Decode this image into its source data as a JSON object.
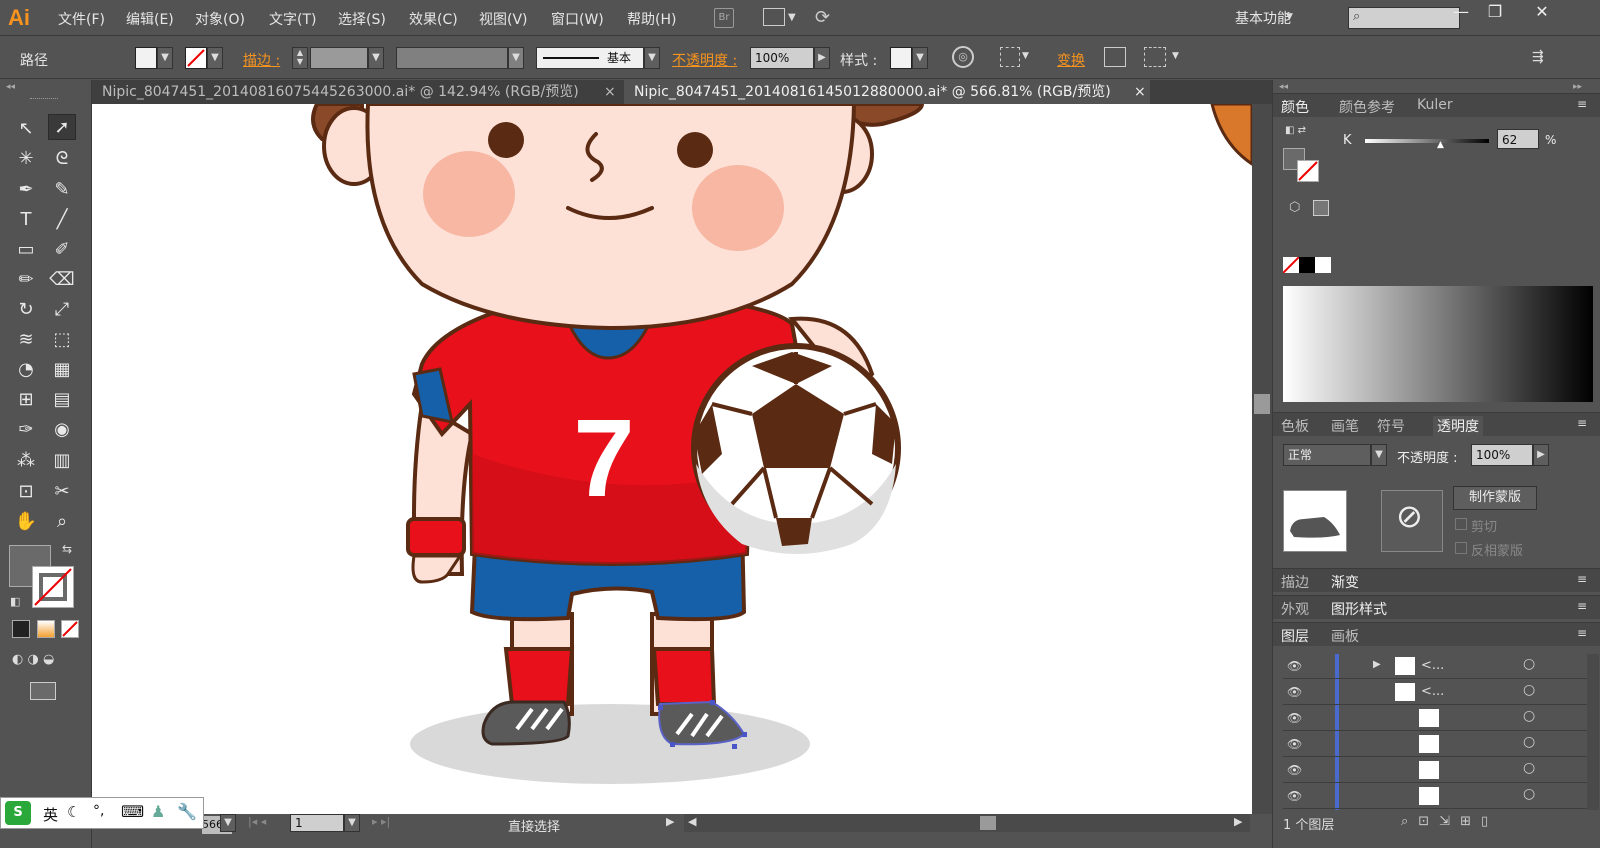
{
  "app": {
    "logo": "Ai"
  },
  "menu": {
    "items": [
      "文件(F)",
      "编辑(E)",
      "对象(O)",
      "文字(T)",
      "选择(S)",
      "效果(C)",
      "视图(V)",
      "窗口(W)",
      "帮助(H)"
    ],
    "bridge_label": "Br"
  },
  "workspace": {
    "label": "基本功能"
  },
  "control": {
    "selection_label": "路径",
    "stroke_label": "描边 :",
    "stroke_profile": "基本",
    "opacity_label": "不透明度 :",
    "opacity_value": "100%",
    "style_label": "样式 :",
    "transform_label": "变换"
  },
  "tabs": [
    {
      "label": "Nipic_8047451_20140816075445263000.ai* @ 142.94% (RGB/预览)",
      "close": "×",
      "active": false
    },
    {
      "label": "Nipic_8047451_20140816145012880000.ai* @ 566.81% (RGB/预览)",
      "close": "×",
      "active": true
    }
  ],
  "artwork": {
    "jersey_number": "7"
  },
  "status": {
    "page": "1",
    "tool": "直接选择",
    "zoom_partial": "566.81"
  },
  "color_panel": {
    "tabs": [
      "颜色",
      "颜色参考",
      "Kuler"
    ],
    "channel": "K",
    "value": "62",
    "unit": "%"
  },
  "swatch_panel": {
    "tabs": [
      "色板",
      "画笔",
      "符号",
      "透明度"
    ]
  },
  "transparency": {
    "mode": "正常",
    "opacity_label": "不透明度 :",
    "opacity_value": "100%",
    "make_mask_button": "制作蒙版",
    "clip_label": "剪切",
    "invert_label": "反相蒙版"
  },
  "stroke_panel": {
    "tabs": [
      "描边",
      "渐变"
    ]
  },
  "appearance_panel": {
    "tabs": [
      "外观",
      "图形样式"
    ]
  },
  "layers_panel": {
    "tabs": [
      "图层",
      "画板"
    ],
    "rows": [
      {
        "name": "<..."
      },
      {
        "name": "<..."
      },
      {
        "name": ""
      },
      {
        "name": ""
      },
      {
        "name": ""
      },
      {
        "name": ""
      }
    ],
    "footer": "1 个图层"
  },
  "ime": {
    "label": "英"
  },
  "colors": {
    "accent": "#f7931e",
    "ui_bg": "#535353",
    "jersey_red": "#e8101a",
    "shorts_blue": "#1560a8",
    "ball_brown": "#5a2a12"
  }
}
